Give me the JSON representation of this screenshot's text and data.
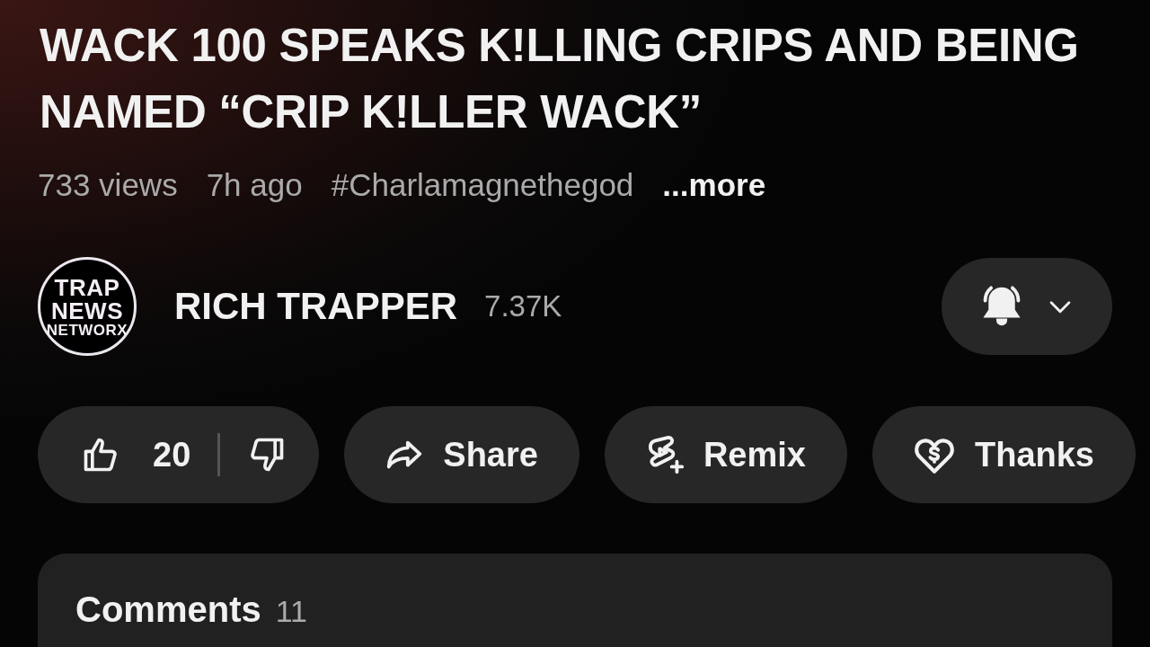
{
  "title": "WACK 100 SPEAKS K!LLING CRIPS AND BEING NAMED “CRIP K!LLER WACK”",
  "meta": {
    "views": "733 views",
    "age": "7h ago",
    "hashtag": "#Charlamagnethegod",
    "more": "...more"
  },
  "channel": {
    "logo_lines": [
      "TRAP",
      "NEWS",
      "NETWORX"
    ],
    "name": "RICH TRAPPER",
    "subscribers": "7.37K",
    "notifications": true
  },
  "actions": [
    {
      "kind": "like",
      "likes": "20"
    },
    {
      "kind": "share",
      "label": "Share"
    },
    {
      "kind": "remix",
      "label": "Remix"
    },
    {
      "kind": "thanks",
      "label": "Thanks"
    }
  ],
  "comments": {
    "label": "Comments",
    "count": "11"
  }
}
